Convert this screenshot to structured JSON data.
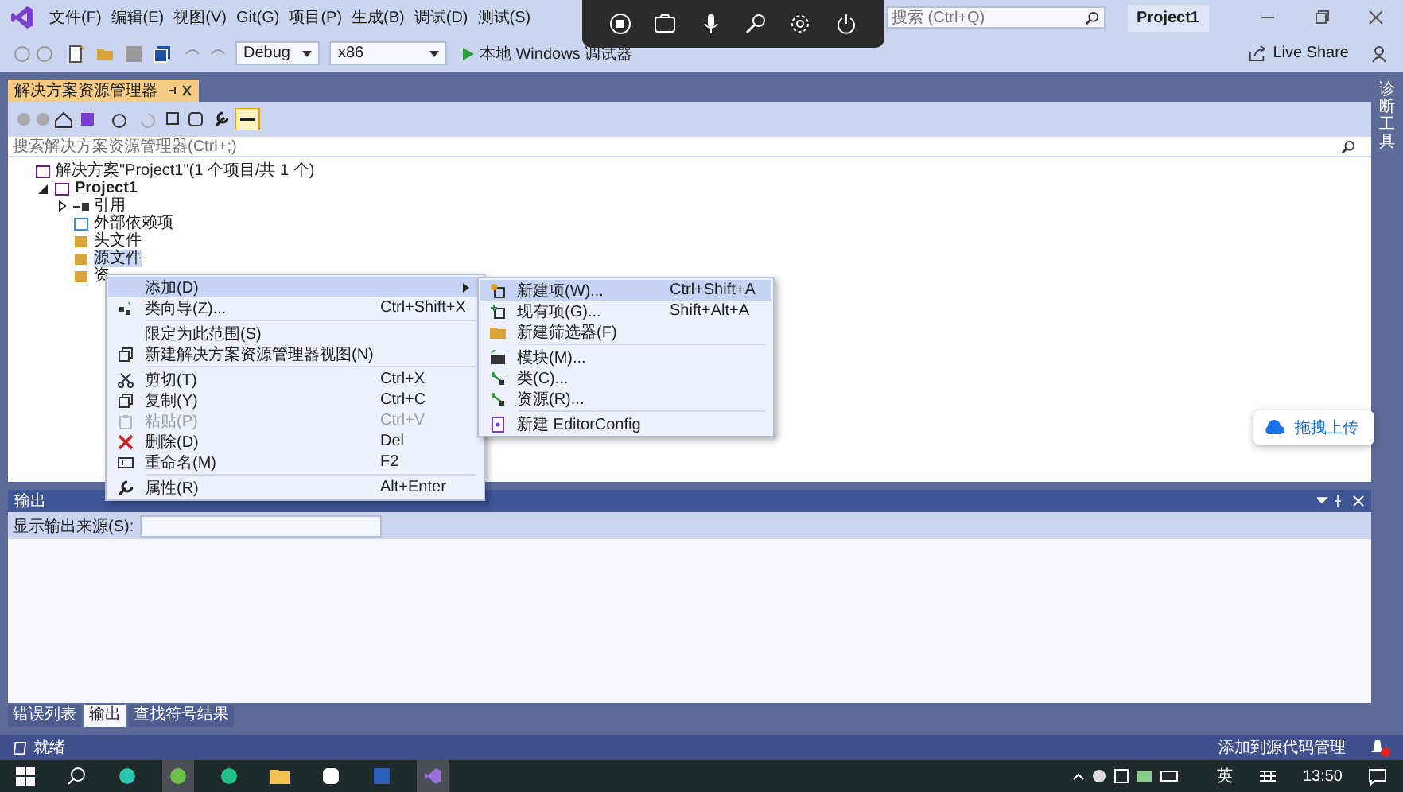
{
  "menu": [
    "文件(F)",
    "编辑(E)",
    "视图(V)",
    "Git(G)",
    "项目(P)",
    "生成(B)",
    "调试(D)",
    "测试(S)"
  ],
  "search": {
    "placeholder": "搜索 (Ctrl+Q)"
  },
  "project_badge": "Project1",
  "toolbar": {
    "config": "Debug",
    "platform": "x86",
    "run": "本地 Windows 调试器"
  },
  "live_share": "Live Share",
  "solution_explorer": {
    "title": "解决方案资源管理器",
    "search_placeholder": "搜索解决方案资源管理器(Ctrl+;)",
    "tree": [
      {
        "label": "解决方案\"Project1\"(1 个项目/共 1 个)",
        "selected": false,
        "children": [
          {
            "label": "Project1",
            "expanded": true,
            "selected": false,
            "children": [
              {
                "label": "引用",
                "kind": "references",
                "expanded": false,
                "selected": false
              },
              {
                "label": "外部依赖项",
                "kind": "dependencies",
                "selected": false
              },
              {
                "label": "头文件",
                "kind": "filter",
                "selected": false
              },
              {
                "label": "源文件",
                "kind": "filter",
                "selected": true
              },
              {
                "label": "资",
                "kind": "filter",
                "selected": false
              }
            ]
          }
        ]
      }
    ]
  },
  "side_tab": "诊断工具",
  "context_menu": {
    "items": [
      {
        "kind": "item",
        "label": "添加(D)",
        "submenu": true,
        "highlighted": true,
        "disabled": false
      },
      {
        "kind": "item",
        "label": "类向导(Z)...",
        "shortcut": "Ctrl+Shift+X",
        "submenu": false,
        "highlighted": false,
        "disabled": false
      },
      {
        "kind": "separator"
      },
      {
        "kind": "item",
        "label": "限定为此范围(S)",
        "submenu": false,
        "highlighted": false,
        "disabled": false
      },
      {
        "kind": "item",
        "label": "新建解决方案资源管理器视图(N)",
        "submenu": false,
        "highlighted": false,
        "disabled": false
      },
      {
        "kind": "separator"
      },
      {
        "kind": "item",
        "label": "剪切(T)",
        "shortcut": "Ctrl+X",
        "submenu": false,
        "highlighted": false,
        "disabled": false
      },
      {
        "kind": "item",
        "label": "复制(Y)",
        "shortcut": "Ctrl+C",
        "submenu": false,
        "highlighted": false,
        "disabled": false
      },
      {
        "kind": "item",
        "label": "粘贴(P)",
        "shortcut": "Ctrl+V",
        "submenu": false,
        "highlighted": false,
        "disabled": true
      },
      {
        "kind": "item",
        "label": "删除(D)",
        "shortcut": "Del",
        "submenu": false,
        "highlighted": false,
        "disabled": false
      },
      {
        "kind": "item",
        "label": "重命名(M)",
        "shortcut": "F2",
        "submenu": false,
        "highlighted": false,
        "disabled": false
      },
      {
        "kind": "separator"
      },
      {
        "kind": "item",
        "label": "属性(R)",
        "shortcut": "Alt+Enter",
        "submenu": false,
        "highlighted": false,
        "disabled": false
      }
    ]
  },
  "submenu": {
    "items": [
      {
        "kind": "item",
        "label": "新建项(W)...",
        "shortcut": "Ctrl+Shift+A",
        "highlighted": true
      },
      {
        "kind": "item",
        "label": "现有项(G)...",
        "shortcut": "Shift+Alt+A",
        "highlighted": false
      },
      {
        "kind": "item",
        "label": "新建筛选器(F)",
        "highlighted": false
      },
      {
        "kind": "separator"
      },
      {
        "kind": "item",
        "label": "模块(M)...",
        "highlighted": false
      },
      {
        "kind": "item",
        "label": "类(C)...",
        "highlighted": false
      },
      {
        "kind": "item",
        "label": "资源(R)...",
        "highlighted": false
      },
      {
        "kind": "separator"
      },
      {
        "kind": "item",
        "label": "新建 EditorConfig",
        "highlighted": false
      }
    ]
  },
  "upload_button": "拖拽上传",
  "output": {
    "title": "输出",
    "source_label": "显示输出来源(S):",
    "tabs": [
      {
        "label": "错误列表",
        "selected": false
      },
      {
        "label": "输出",
        "selected": true
      },
      {
        "label": "查找符号结果",
        "selected": false
      }
    ]
  },
  "status": {
    "text": "就绪",
    "source_control": "添加到源代码管理"
  },
  "taskbar": {
    "ime": "英",
    "time": "13:50"
  }
}
